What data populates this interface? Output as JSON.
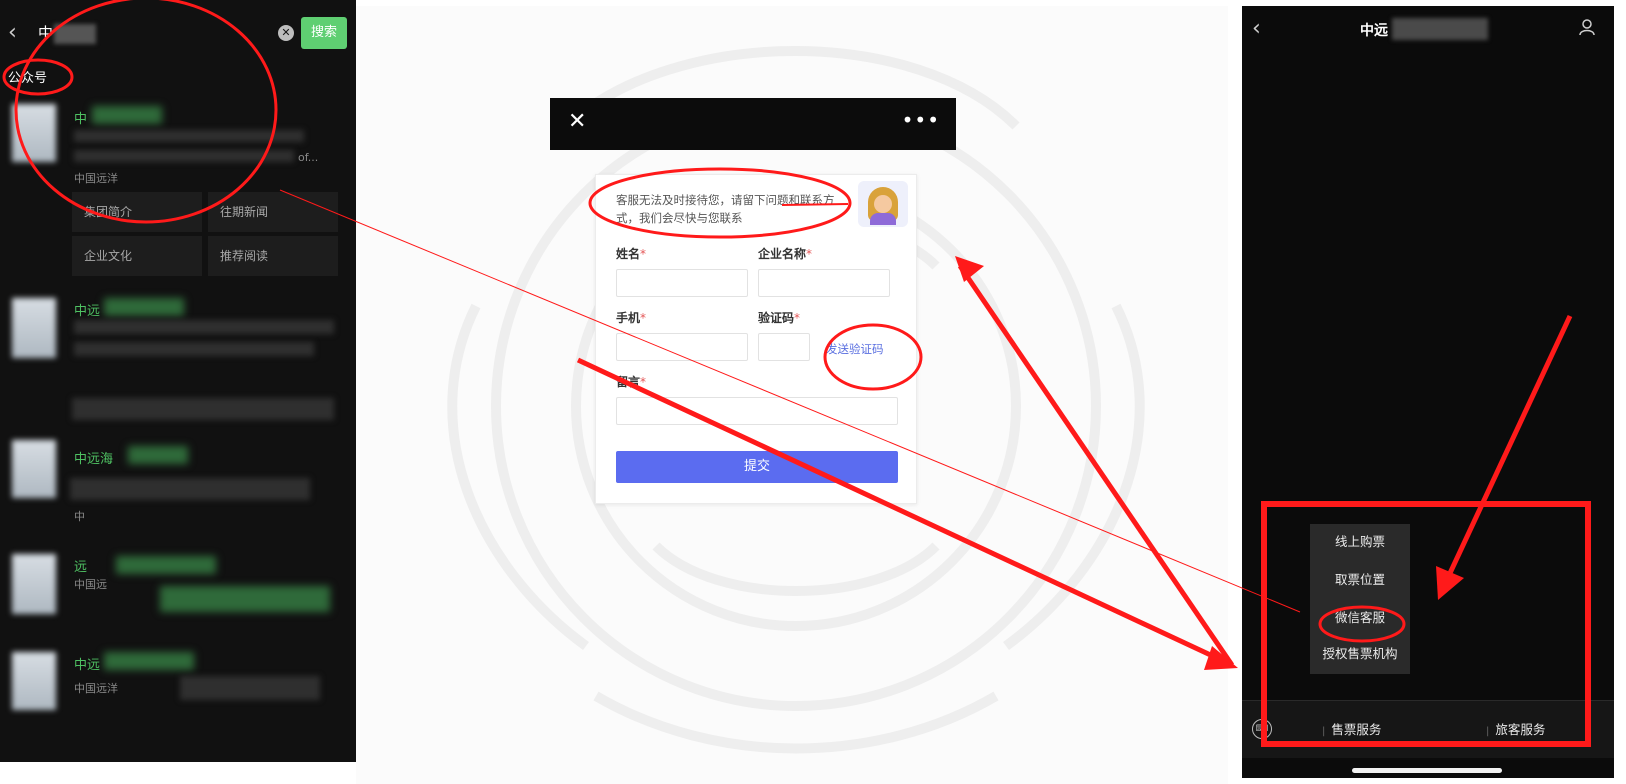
{
  "left_phone": {
    "search_query": "中",
    "search_button": "搜索",
    "section_label": "公众号",
    "account_names": [
      "中",
      "中远",
      "中远海",
      "远",
      "中远"
    ],
    "account_sub_texts": [
      "中国远洋",
      "中国远",
      "中",
      "中国远洋"
    ],
    "menu": [
      "集团简介",
      "往期新闻",
      "企业文化",
      "推荐阅读"
    ],
    "truncated_text": "of..."
  },
  "form": {
    "intro": "客服无法及时接待您，请留下问题和联系方式，我们会尽快与您联系",
    "name_label": "姓名",
    "company_label": "企业名称",
    "phone_label": "手机",
    "code_label": "验证码",
    "message_label": "留言",
    "required_mark": "*",
    "send_code": "发送验证码",
    "submit": "提交",
    "close_glyph": "✕",
    "more_glyph": "•••"
  },
  "right_phone": {
    "title": "中远",
    "popup_items": [
      "线上购票",
      "取票位置",
      "微信客服",
      "授权售票机构"
    ],
    "tabs": [
      "售票服务",
      "旅客服务"
    ]
  },
  "colors": {
    "annotation_red": "#ff1a1a",
    "wechat_green": "#5fcf72",
    "submit_blue": "#5b6cf0",
    "name_green": "#4fc263"
  }
}
